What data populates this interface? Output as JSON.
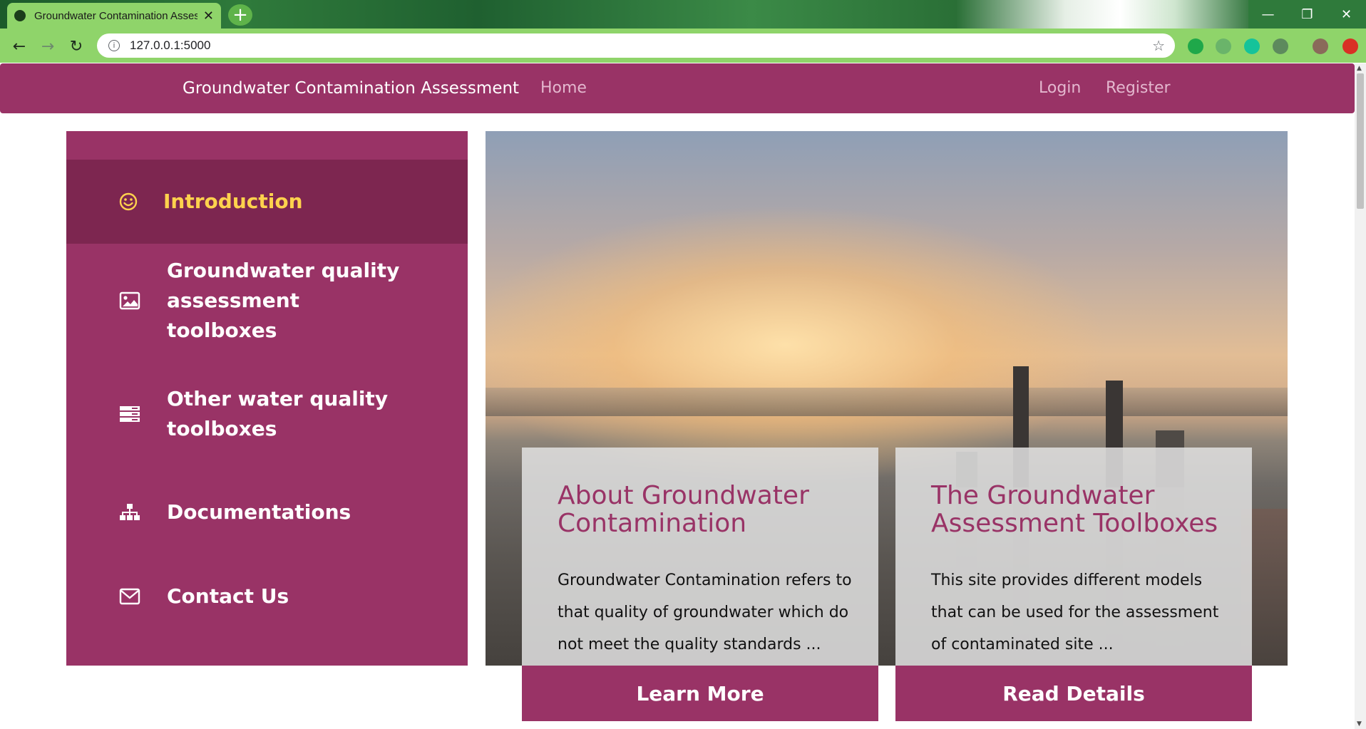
{
  "browser": {
    "tab_title": "Groundwater Contamination Assessment",
    "tab_close": "✕",
    "new_tab": "+",
    "url": "127.0.0.1:5000",
    "window_controls": [
      "—",
      "❐",
      "✕"
    ]
  },
  "navbar": {
    "brand": "Groundwater Contamination Assessment",
    "home": "Home",
    "login": "Login",
    "register": "Register",
    "color": "#993366"
  },
  "sidebar": {
    "items": [
      {
        "label": "Introduction",
        "icon": "smiley-icon",
        "active": true
      },
      {
        "label": "Groundwater quality assessment toolboxes",
        "icon": "image-icon",
        "active": false
      },
      {
        "label": "Other water quality toolboxes",
        "icon": "server-icon",
        "active": false
      },
      {
        "label": "Documentations",
        "icon": "sitemap-icon",
        "active": false
      },
      {
        "label": "Contact Us",
        "icon": "envelope-icon",
        "active": false
      }
    ],
    "active_color": "#ffd24d"
  },
  "cards": [
    {
      "title": "About Groundwater Contamination",
      "text": "Groundwater Contamination refers to that quality of groundwater which do not meet the quality standards ...",
      "button": "Learn More"
    },
    {
      "title": "The Groundwater Assessment Toolboxes",
      "text": "This site provides different models that can be used for the assessment of contaminated site ...",
      "button": "Read Details"
    }
  ]
}
